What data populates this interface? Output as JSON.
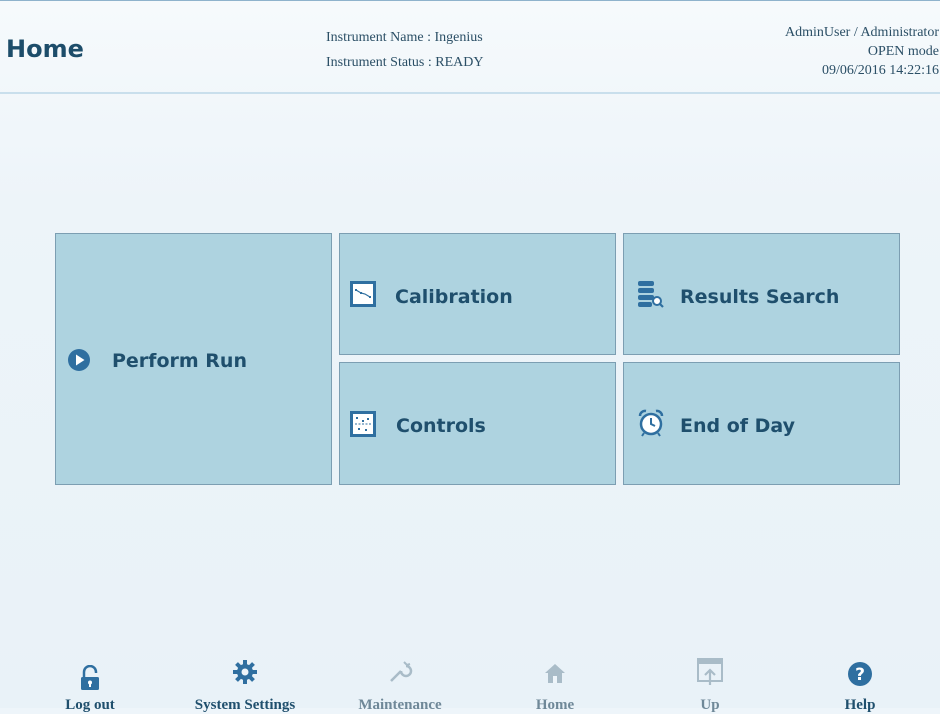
{
  "header": {
    "title": "Home",
    "instrument_name": "Instrument Name : Ingenius",
    "instrument_status": "Instrument Status : READY",
    "user": "AdminUser / Administrator",
    "mode": "OPEN mode",
    "datetime": "09/06/2016 14:22:16"
  },
  "tiles": {
    "perform_run": "Perform Run",
    "calibration": "Calibration",
    "results_search": "Results Search",
    "controls": "Controls",
    "end_of_day": "End of Day"
  },
  "bottom_nav": {
    "logout": "Log out",
    "system_settings": "System Settings",
    "maintenance": "Maintenance",
    "home": "Home",
    "up": "Up",
    "help": "Help"
  },
  "colors": {
    "tile_bg": "#aed3e0",
    "accent": "#2f6fa0",
    "title_text": "#1d4d6a"
  }
}
